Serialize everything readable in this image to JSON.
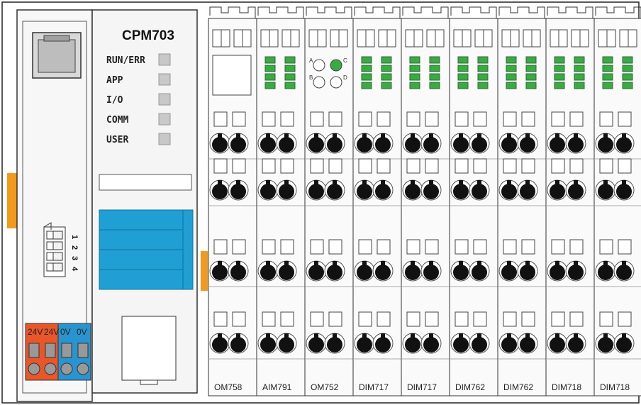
{
  "controller": {
    "model": "CPM703",
    "leds": [
      "RUN/ERR",
      "APP",
      "I/O",
      "COMM",
      "USER"
    ],
    "power_terminals": [
      "24V",
      "24V",
      "0V",
      "0V"
    ],
    "dip_labels": [
      "1",
      "2",
      "3",
      "4"
    ]
  },
  "io_modules": {
    "labels": [
      "OM758",
      "AIM791",
      "OM752",
      "DIM717",
      "DIM717",
      "DIM762",
      "DIM762",
      "DIM718",
      "DIM718"
    ]
  },
  "om752_leds": [
    "A",
    "B",
    "C",
    "D"
  ],
  "colors": {
    "led_green": "#3aaa45",
    "connector_blue": "#1f9fd4",
    "power_red": "#e8562a",
    "power_blue": "#2a94d0",
    "rail_orange": "#f39a1e",
    "terminal_black": "#111111"
  }
}
